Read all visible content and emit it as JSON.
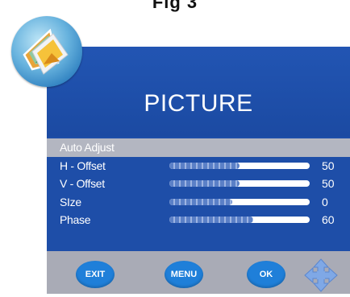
{
  "figure": {
    "caption": "Fig 3"
  },
  "app_icon": {
    "icon": "picture-icon"
  },
  "menu": {
    "title": "PICTURE",
    "items": [
      {
        "label": "Auto Adjust",
        "selected": true
      },
      {
        "label": "H - Offset",
        "value": "50",
        "level": 0.5
      },
      {
        "label": "V - Offset",
        "value": "50",
        "level": 0.5
      },
      {
        "label": "SIze",
        "value": "0",
        "level": 0.45
      },
      {
        "label": "Phase",
        "value": "60",
        "level": 0.6
      }
    ]
  },
  "buttons": {
    "exit_label": "EXIT",
    "menu_label": "MENU",
    "ok_label": "OK",
    "nav_icon": "four-way-arrows-icon"
  },
  "colors": {
    "panel": "#1e4ea8",
    "selected_row": "#b3b6c1",
    "button_bar": "#a9abb6",
    "button": "#1f7fd9"
  }
}
